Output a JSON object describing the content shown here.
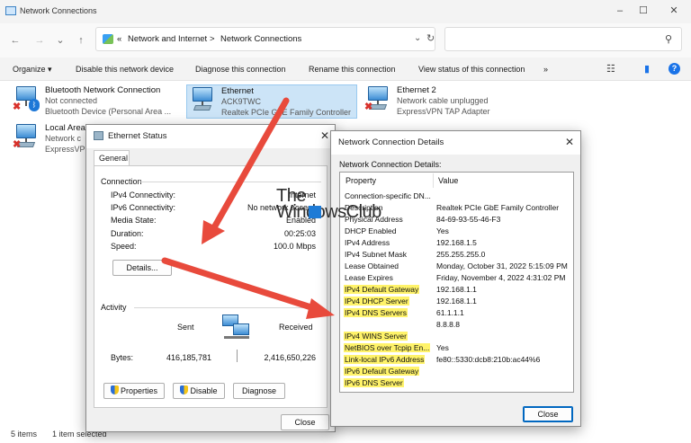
{
  "window": {
    "title": "Network Connections",
    "controls": [
      "–",
      "☐",
      "✕"
    ]
  },
  "address": {
    "chevron": "«",
    "crumbs": [
      "Network and Internet",
      "Network Connections"
    ],
    "separator": ">",
    "dropdown": "⌄",
    "refresh": "↻",
    "search_placeholder": ""
  },
  "nav": {
    "back": "←",
    "forward": "→",
    "recent": "⌄",
    "up": "↑"
  },
  "commands": {
    "organize": "Organize ▾",
    "disable": "Disable this network device",
    "diagnose": "Diagnose this connection",
    "rename": "Rename this connection",
    "view_status": "View status of this connection",
    "more": "»",
    "view_icon": "☷",
    "pane_icon": "▮",
    "help": "?"
  },
  "connections": [
    {
      "name": "Bluetooth Network Connection",
      "l2": "Not connected",
      "l3": "Bluetooth Device (Personal Area ..."
    },
    {
      "name": "Ethernet",
      "l2": "ACK9TWC",
      "l3": "Realtek PCIe GbE Family Controller"
    },
    {
      "name": "Ethernet 2",
      "l2": "Network cable unplugged",
      "l3": "ExpressVPN TAP Adapter"
    },
    {
      "name": "Local Area",
      "l2": "Network c",
      "l3": "ExpressVP"
    }
  ],
  "status_bar": {
    "items": "5 items",
    "selected": "1 item selected"
  },
  "ethernet_status": {
    "title": "Ethernet Status",
    "tab": "General",
    "connection_group": "Connection",
    "rows": [
      {
        "label": "IPv4 Connectivity:",
        "value": "Internet"
      },
      {
        "label": "IPv6 Connectivity:",
        "value": "No network access"
      },
      {
        "label": "Media State:",
        "value": "Enabled"
      },
      {
        "label": "Duration:",
        "value": "00:25:03"
      },
      {
        "label": "Speed:",
        "value": "100.0 Mbps"
      }
    ],
    "details_button": "Details...",
    "activity_group": "Activity",
    "sent_label": "Sent",
    "received_label": "Received",
    "bytes_label": "Bytes:",
    "bytes_sent": "416,185,781",
    "bytes_received": "2,416,650,226",
    "properties_button": "Properties",
    "disable_button": "Disable",
    "diagnose_button": "Diagnose",
    "close_button": "Close"
  },
  "details": {
    "title": "Network Connection Details",
    "caption": "Network Connection Details:",
    "col_property": "Property",
    "col_value": "Value",
    "rows": [
      {
        "p": "Connection-specific DN...",
        "v": ""
      },
      {
        "p": "Description",
        "v": "Realtek PCIe GbE Family Controller"
      },
      {
        "p": "Physical Address",
        "v": "84-69-93-55-46-F3"
      },
      {
        "p": "DHCP Enabled",
        "v": "Yes"
      },
      {
        "p": "IPv4 Address",
        "v": "192.168.1.5"
      },
      {
        "p": "IPv4 Subnet Mask",
        "v": "255.255.255.0"
      },
      {
        "p": "Lease Obtained",
        "v": "Monday, October 31, 2022 5:15:09 PM"
      },
      {
        "p": "Lease Expires",
        "v": "Friday, November 4, 2022 4:31:02 PM"
      },
      {
        "p": "IPv4 Default Gateway",
        "v": "192.168.1.1"
      },
      {
        "p": "IPv4 DHCP Server",
        "v": "192.168.1.1"
      },
      {
        "p": "IPv4 DNS Servers",
        "v": "61.1.1.1"
      },
      {
        "p": "",
        "v": "8.8.8.8"
      },
      {
        "p": "IPv4 WINS Server",
        "v": ""
      },
      {
        "p": "NetBIOS over Tcpip En...",
        "v": "Yes"
      },
      {
        "p": "Link-local IPv6 Address",
        "v": "fe80::5330:dcb8:210b:ac44%6"
      },
      {
        "p": "IPv6 Default Gateway",
        "v": ""
      },
      {
        "p": "IPv6 DNS Server",
        "v": ""
      }
    ],
    "close_button": "Close",
    "close_x": "✕"
  },
  "watermark": {
    "line1": "The",
    "line2": "WindowsClub"
  },
  "colors": {
    "highlight": "#fff36a",
    "arrow": "#e84a3c",
    "selection": "#cce4f7",
    "accent": "#0067c0"
  }
}
